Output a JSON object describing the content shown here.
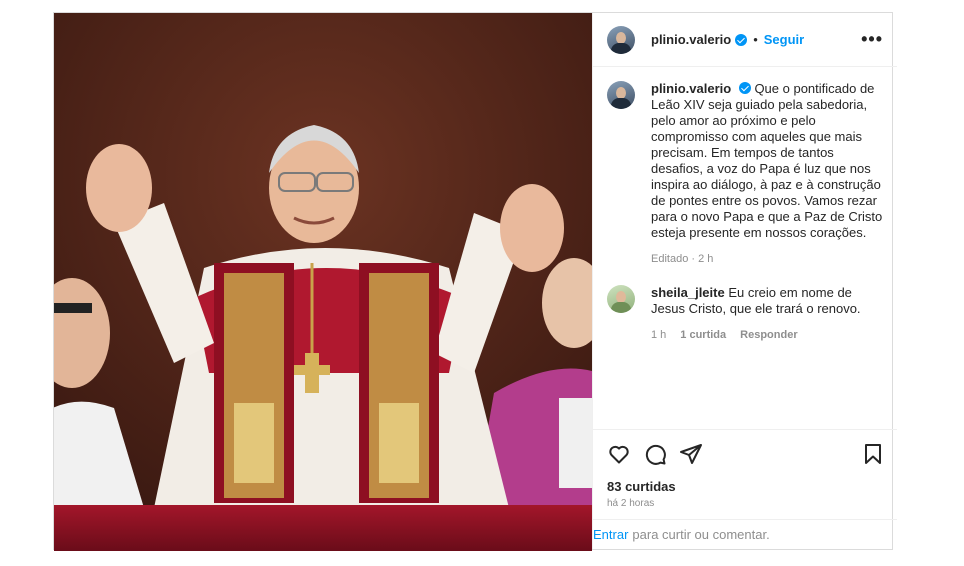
{
  "post": {
    "username": "plinio.valerio",
    "follow_label": "Seguir",
    "separator": "•",
    "more_label": "•••",
    "caption": "Que o pontificado de Leão XIV seja guiado pela sabedoria, pelo amor ao próximo e pelo compromisso com aqueles que mais precisam. Em tempos de tantos desafios, a voz do Papa é luz que nos inspira ao diálogo, à paz e à construção de pontes entre os povos. Vamos rezar para o novo Papa e que a Paz de Cristo esteja presente em nossos corações.",
    "caption_meta": "Editado · 2 h",
    "likes": "83 curtidas",
    "time": "há 2 horas"
  },
  "comments": [
    {
      "username": "sheila_jleite",
      "text": "Eu creio em nome de Jesus Cristo, que ele trará o renovo.",
      "time": "1 h",
      "likes": "1 curtida",
      "reply": "Responder"
    }
  ],
  "comment_box": {
    "enter": "Entrar",
    "placeholder": "para curtir ou comentar."
  },
  "icons": {
    "like": "heart-icon",
    "comment": "comment-icon",
    "share": "share-icon",
    "save": "bookmark-icon",
    "verified": "verified-badge-icon"
  },
  "colors": {
    "accent": "#0095f6",
    "vestment_red": "#9b1b2e",
    "gold": "#c9a24a"
  }
}
